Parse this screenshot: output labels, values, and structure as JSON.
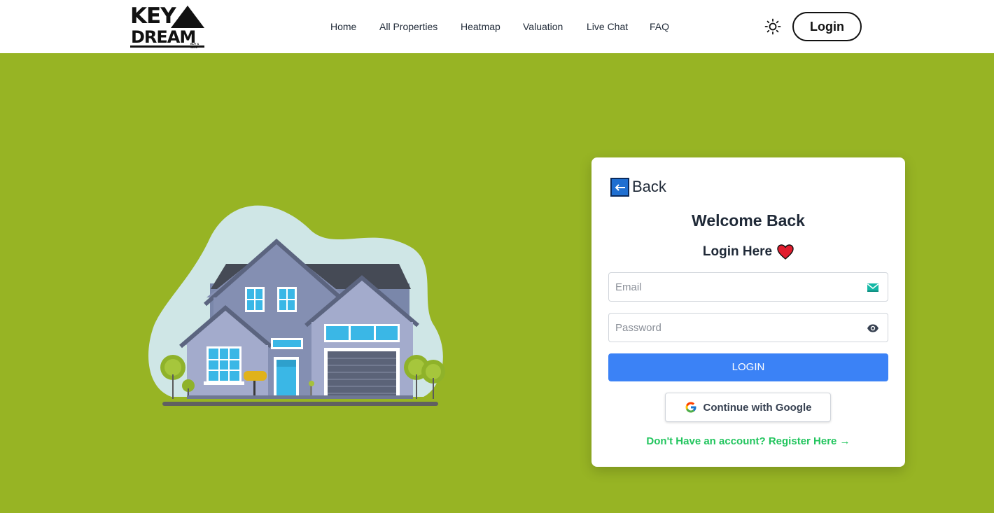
{
  "brand": {
    "logo_line1": "KEY",
    "logo_line2": "DREAM",
    "logo_tagline": "BUY & SELL"
  },
  "nav": {
    "links": [
      "Home",
      "All Properties",
      "Heatmap",
      "Valuation",
      "Live Chat",
      "FAQ"
    ],
    "login_label": "Login",
    "theme_icon": "sun-icon"
  },
  "colors": {
    "page_background": "#97b424",
    "primary_button": "#3b82f6",
    "register_link": "#22c55e"
  },
  "login_card": {
    "back_label": "Back",
    "title": "Welcome Back",
    "subtitle": "Login Here",
    "email_placeholder": "Email",
    "password_placeholder": "Password",
    "submit_label": "LOGIN",
    "google_label": "Continue with Google",
    "register_text": "Don't Have an account? Register Here →"
  }
}
